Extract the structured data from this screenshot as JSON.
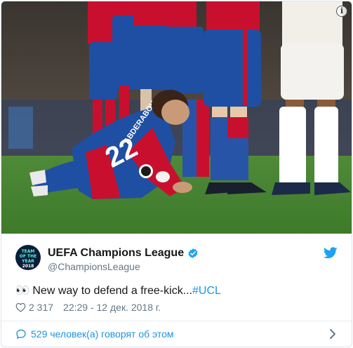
{
  "media": {
    "jersey_number": "22",
    "jersey_name": "ABDERABOV",
    "info_icon": "info-icon"
  },
  "avatar": {
    "line1": "TEAM",
    "line2": "OF THE",
    "line3": "YEAR",
    "line4": "2018"
  },
  "account": {
    "name": "UEFA Champions League",
    "handle": "@ChampionsLeague",
    "verified": true
  },
  "tweet": {
    "emoji": "👀",
    "text": " New way to defend a free-kick...",
    "hashtag": "#UCL"
  },
  "meta": {
    "likes": "2 317",
    "timestamp": "22:29 - 12 дек. 2018 г."
  },
  "footer": {
    "label": "529 человек(а) говорят об этом"
  },
  "colors": {
    "link": "#1b95e0",
    "muted": "#657786",
    "cska_red": "#c8102e",
    "cska_blue": "#1f4fa3"
  }
}
